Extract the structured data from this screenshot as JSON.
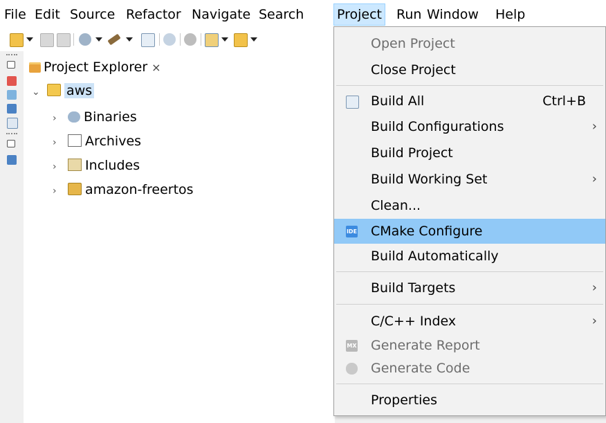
{
  "menubar": {
    "items": [
      "File",
      "Edit",
      "Source",
      "Refactor",
      "Navigate",
      "Search",
      "Project",
      "Run",
      "Window",
      "Help"
    ],
    "active": "Project"
  },
  "toolbar": {
    "icons": [
      "new-wizard-icon",
      "save-icon",
      "save-all-icon",
      "debug-icon",
      "build-hammer-icon",
      "build-all-icon",
      "connect-icon",
      "launch-icon",
      "new-cpp-project-icon",
      "new-folder-icon"
    ]
  },
  "trim": {
    "icons": [
      "restore-icon",
      "person-icon",
      "tasks-icon",
      "console-icon",
      "table-icon",
      "restore-icon",
      "monitor-icon"
    ]
  },
  "explorer": {
    "tab_label": "Project Explorer",
    "close_glyph": "×",
    "root": {
      "label": "aws",
      "expanded": true,
      "selected": true,
      "icon": "c-project-folder-icon"
    },
    "children": [
      {
        "label": "Binaries",
        "icon": "binaries-icon"
      },
      {
        "label": "Archives",
        "icon": "archives-icon"
      },
      {
        "label": "Includes",
        "icon": "includes-icon"
      },
      {
        "label": "amazon-freertos",
        "icon": "linked-folder-icon"
      }
    ]
  },
  "project_menu": {
    "items": [
      {
        "label": "Open Project",
        "disabled": true
      },
      {
        "label": "Close Project"
      },
      {
        "separator": true
      },
      {
        "label": "Build All",
        "accelerator": "Ctrl+B",
        "icon": "build-all-icon"
      },
      {
        "label": "Build Configurations",
        "submenu": true
      },
      {
        "label": "Build Project"
      },
      {
        "label": "Build Working Set",
        "submenu": true
      },
      {
        "label": "Clean..."
      },
      {
        "label": "CMake Configure",
        "icon": "ide-icon",
        "icon_text": "IDE",
        "highlighted": true
      },
      {
        "label": "Build Automatically"
      },
      {
        "separator": true
      },
      {
        "label": "Build Targets",
        "submenu": true
      },
      {
        "separator": true
      },
      {
        "label": "C/C++ Index",
        "submenu": true
      },
      {
        "label": "Generate Report",
        "disabled": true,
        "icon": "mx-icon",
        "icon_text": "MX"
      },
      {
        "label": "Generate Code",
        "disabled": true,
        "icon": "generate-code-icon"
      },
      {
        "separator": true
      },
      {
        "label": "Properties"
      }
    ],
    "submenu_glyph": "›"
  },
  "colors": {
    "menu_highlight": "#91c9f7",
    "menubar_active": "#cce8ff",
    "selection": "#cde3f7"
  }
}
